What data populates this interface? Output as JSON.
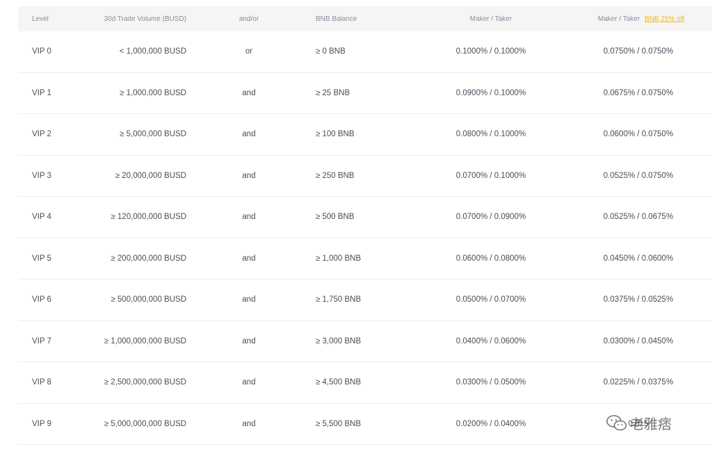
{
  "header": {
    "level": "Level",
    "volume": "30d Trade Volume (BUSD)",
    "andor": "and/or",
    "bnb": "BNB Balance",
    "maker_taker": "Maker / Taker",
    "maker_taker_discount": "Maker / Taker",
    "discount_link": "BNB 25% off"
  },
  "rows": [
    {
      "level": "VIP 0",
      "volume": "< 1,000,000 BUSD",
      "andor": "or",
      "bnb": "≥ 0 BNB",
      "mt": "0.1000% / 0.1000%",
      "mt_discount": "0.0750% / 0.0750%"
    },
    {
      "level": "VIP 1",
      "volume": "≥ 1,000,000 BUSD",
      "andor": "and",
      "bnb": "≥ 25 BNB",
      "mt": "0.0900% / 0.1000%",
      "mt_discount": "0.0675% / 0.0750%"
    },
    {
      "level": "VIP 2",
      "volume": "≥ 5,000,000 BUSD",
      "andor": "and",
      "bnb": "≥ 100 BNB",
      "mt": "0.0800% / 0.1000%",
      "mt_discount": "0.0600% / 0.0750%"
    },
    {
      "level": "VIP 3",
      "volume": "≥ 20,000,000 BUSD",
      "andor": "and",
      "bnb": "≥ 250 BNB",
      "mt": "0.0700% / 0.1000%",
      "mt_discount": "0.0525% / 0.0750%"
    },
    {
      "level": "VIP 4",
      "volume": "≥ 120,000,000 BUSD",
      "andor": "and",
      "bnb": "≥ 500 BNB",
      "mt": "0.0700% / 0.0900%",
      "mt_discount": "0.0525% / 0.0675%"
    },
    {
      "level": "VIP 5",
      "volume": "≥ 200,000,000 BUSD",
      "andor": "and",
      "bnb": "≥ 1,000 BNB",
      "mt": "0.0600% / 0.0800%",
      "mt_discount": "0.0450% / 0.0600%"
    },
    {
      "level": "VIP 6",
      "volume": "≥ 500,000,000 BUSD",
      "andor": "and",
      "bnb": "≥ 1,750 BNB",
      "mt": "0.0500% / 0.0700%",
      "mt_discount": "0.0375% / 0.0525%"
    },
    {
      "level": "VIP 7",
      "volume": "≥ 1,000,000,000 BUSD",
      "andor": "and",
      "bnb": "≥ 3,000 BNB",
      "mt": "0.0400% / 0.0600%",
      "mt_discount": "0.0300% / 0.0450%"
    },
    {
      "level": "VIP 8",
      "volume": "≥ 2,500,000,000 BUSD",
      "andor": "and",
      "bnb": "≥ 4,500 BNB",
      "mt": "0.0300% / 0.0500%",
      "mt_discount": "0.0225% / 0.0375%"
    },
    {
      "level": "VIP 9",
      "volume": "≥ 5,000,000,000 BUSD",
      "andor": "and",
      "bnb": "≥ 5,500 BNB",
      "mt": "0.0200% / 0.0400%",
      "mt_discount": "0.015"
    }
  ],
  "watermark": {
    "text": "老雅痞",
    "icon": "wechat-icon"
  },
  "colors": {
    "accent": "#f0b90b",
    "header_bg": "#f5f5f5",
    "divider": "#eaecef"
  }
}
